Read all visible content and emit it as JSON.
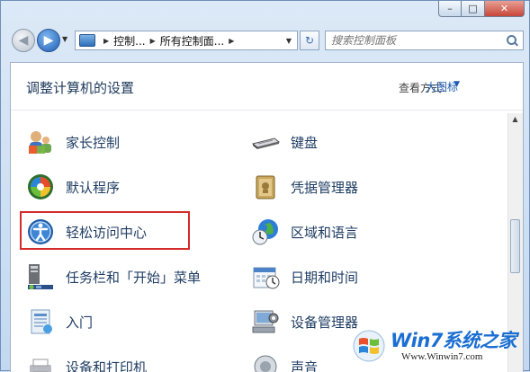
{
  "nav": {
    "breadcrumb": [
      "控制...",
      "所有控制面..."
    ],
    "search_placeholder": "搜索控制面板"
  },
  "header": {
    "title": "调整计算机的设置",
    "view_label": "查看方式:",
    "view_value": "大图标"
  },
  "items_left": [
    {
      "label": "家长控制",
      "icon": "parental-controls-icon"
    },
    {
      "label": "默认程序",
      "icon": "default-programs-icon"
    },
    {
      "label": "轻松访问中心",
      "icon": "ease-of-access-icon"
    },
    {
      "label": "任务栏和「开始」菜单",
      "icon": "taskbar-start-menu-icon"
    },
    {
      "label": "入门",
      "icon": "getting-started-icon"
    },
    {
      "label": "设备和打印机",
      "icon": "devices-printers-icon"
    }
  ],
  "items_right": [
    {
      "label": "键盘",
      "icon": "keyboard-icon"
    },
    {
      "label": "凭据管理器",
      "icon": "credential-manager-icon"
    },
    {
      "label": "区域和语言",
      "icon": "region-language-icon"
    },
    {
      "label": "日期和时间",
      "icon": "date-time-icon"
    },
    {
      "label": "设备管理器",
      "icon": "device-manager-icon"
    },
    {
      "label": "声音",
      "icon": "sound-icon"
    }
  ],
  "watermark": {
    "title": "Win7系统之家",
    "url": "Www.Winwin7.com"
  },
  "colors": {
    "link": "#1f3d63",
    "highlight": "#d42b2b"
  }
}
